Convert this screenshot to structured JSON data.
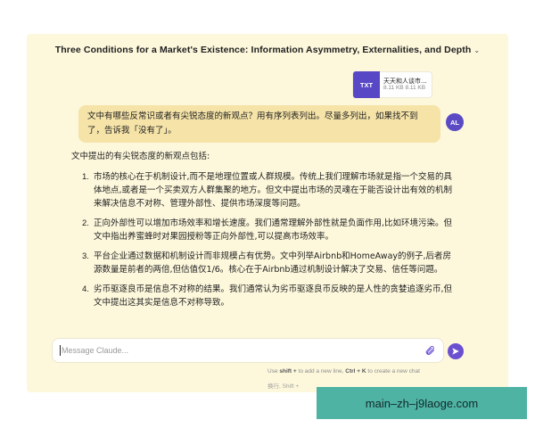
{
  "conversation": {
    "title": "Three Conditions for a Market's Existence: Information Asymmetry, Externalities, and Depth",
    "title_chevron": "⌄"
  },
  "attachment": {
    "type_label": "TXT",
    "name": "天天和人谈市...",
    "size": "8.11 KB 8.11 KB"
  },
  "user_message": {
    "avatar_initials": "AL",
    "text": "文中有哪些反常识或者有尖锐态度的新观点？用有序列表列出。尽量多列出，如果找不到了，告诉我「没有了」。"
  },
  "assistant_message": {
    "intro": "文中提出的有尖锐态度的新观点包括:",
    "items": [
      {
        "num": "1.",
        "text": "市场的核心在于机制设计,而不是地理位置或人群规模。传统上我们理解市场就是指一个交易的具体地点,或者是一个买卖双方人群集聚的地方。但文中提出市场的灵魂在于能否设计出有效的机制来解决信息不对称、管理外部性、提供市场深度等问题。"
      },
      {
        "num": "2.",
        "text": "正向外部性可以增加市场效率和增长速度。我们通常理解外部性就是负面作用,比如环境污染。但文中指出养蜜蜂时对果园授粉等正向外部性,可以提高市场效率。"
      },
      {
        "num": "3.",
        "text": "平台企业通过数据和机制设计而非规模占有优势。文中列举Airbnb和HomeAway的例子,后者房源数量是前者的两倍,但估值仅1/6。核心在于Airbnb通过机制设计解决了交易、信任等问题。"
      },
      {
        "num": "4.",
        "text": "劣币驱逐良币是信息不对称的结果。我们通常认为劣币驱逐良币反映的是人性的贪婪追逐劣币,但文中提出这其实是信息不对称导致。"
      }
    ]
  },
  "composer": {
    "placeholder": "Message Claude...",
    "hint_prefix": "Use",
    "hint_key1": "shift +",
    "hint_mid": "to add a new line,",
    "hint_key2": "Ctrl + K",
    "hint_suffix": "to create a new chat",
    "hint2": "换行, Shift +"
  },
  "watermark": {
    "text": "main–zh–j9laoge.com"
  },
  "colors": {
    "page_bg": "#fdf8dc",
    "user_bubble": "#f5e3a8",
    "accent": "#6a4fd1",
    "watermark_bg": "#4fb3a4"
  }
}
